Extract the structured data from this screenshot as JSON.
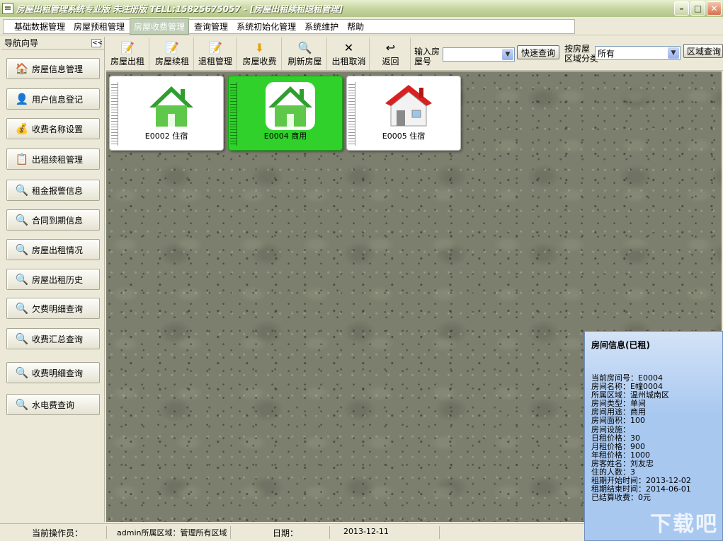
{
  "window": {
    "title": "房屋出租管理系统专业版 未注册版 TELL:15825675057 - [房屋出租续租退租管理]",
    "minimize_icon": "minimize-icon",
    "maximize_icon": "maximize-icon",
    "close_icon": "close-icon"
  },
  "menu": [
    "基础数据管理",
    "房屋预租管理",
    "房屋收费管理",
    "查询管理",
    "系统初始化管理",
    "系统维护",
    "帮助"
  ],
  "nav": {
    "header": "导航向导",
    "collapse": "<<",
    "items": [
      {
        "label": "房屋信息管理",
        "icon": "house-info-icon"
      },
      {
        "label": "用户信息登记",
        "icon": "user-register-icon"
      },
      {
        "label": "收费名称设置",
        "icon": "money-bag-icon"
      },
      {
        "label": "出租续租管理",
        "icon": "rent-renew-icon"
      },
      {
        "label": "租金报警信息",
        "icon": "search-report-icon"
      },
      {
        "label": "合同到期信息",
        "icon": "search-report-icon"
      },
      {
        "label": "房屋出租情况",
        "icon": "search-report-icon"
      },
      {
        "label": "房屋出租历史",
        "icon": "search-report-icon"
      },
      {
        "label": "欠费明细查询",
        "icon": "search-report-icon"
      },
      {
        "label": "收费汇总查询",
        "icon": "search-report-icon"
      },
      {
        "label": "收费明细查询",
        "icon": "search-report-icon"
      },
      {
        "label": "水电费查询",
        "icon": "search-report-icon"
      }
    ]
  },
  "toolbar": {
    "buttons": [
      {
        "label": "房屋出租",
        "icon": "rent-out-icon"
      },
      {
        "label": "房屋续租",
        "icon": "renew-icon"
      },
      {
        "label": "退租管理",
        "icon": "return-lease-icon"
      },
      {
        "label": "房屋收费",
        "icon": "collect-fee-icon"
      },
      {
        "label": "刷新房屋",
        "icon": "refresh-icon"
      },
      {
        "label": "出租取消",
        "icon": "cancel-x-icon"
      },
      {
        "label": "返回",
        "icon": "return-icon"
      }
    ],
    "room_input_label_1": "输入房",
    "room_input_label_2": "屋号",
    "room_input_value": "",
    "quick_query": "快速查询",
    "region_label_1": "按房屋",
    "region_label_2": "区域分类",
    "region_value": "所有",
    "region_query": "区域查询"
  },
  "rooms": [
    {
      "label": "E0002 住宿",
      "icon": "green-house-icon",
      "selected": false
    },
    {
      "label": "E0004 商用",
      "icon": "green-house-icon",
      "selected": true
    },
    {
      "label": "E0005 住宿",
      "icon": "red-roof-house-icon",
      "selected": false
    }
  ],
  "info": {
    "title": "房间信息(已租)",
    "lines": [
      "当前房间号：E0004",
      "房间名称：E幢0004",
      "所属区域：温州城南区",
      "房间类型：单间",
      "房间用途：商用",
      "房间面积：100",
      "房间设施：",
      "日租价格：30",
      "月租价格：900",
      "年租价格：1000",
      "房客姓名：刘友忠",
      "住的人数：3",
      "租期开始时间：2013-12-02",
      "租期结束时间：2014-06-01",
      "已结算收费：0元"
    ],
    "watermark": "下载吧"
  },
  "status": {
    "operator_label": "当前操作员：",
    "operator_value": "admin所属区域：管理所有区域",
    "date_label": "日期：",
    "date_value": "2013-12-11"
  }
}
